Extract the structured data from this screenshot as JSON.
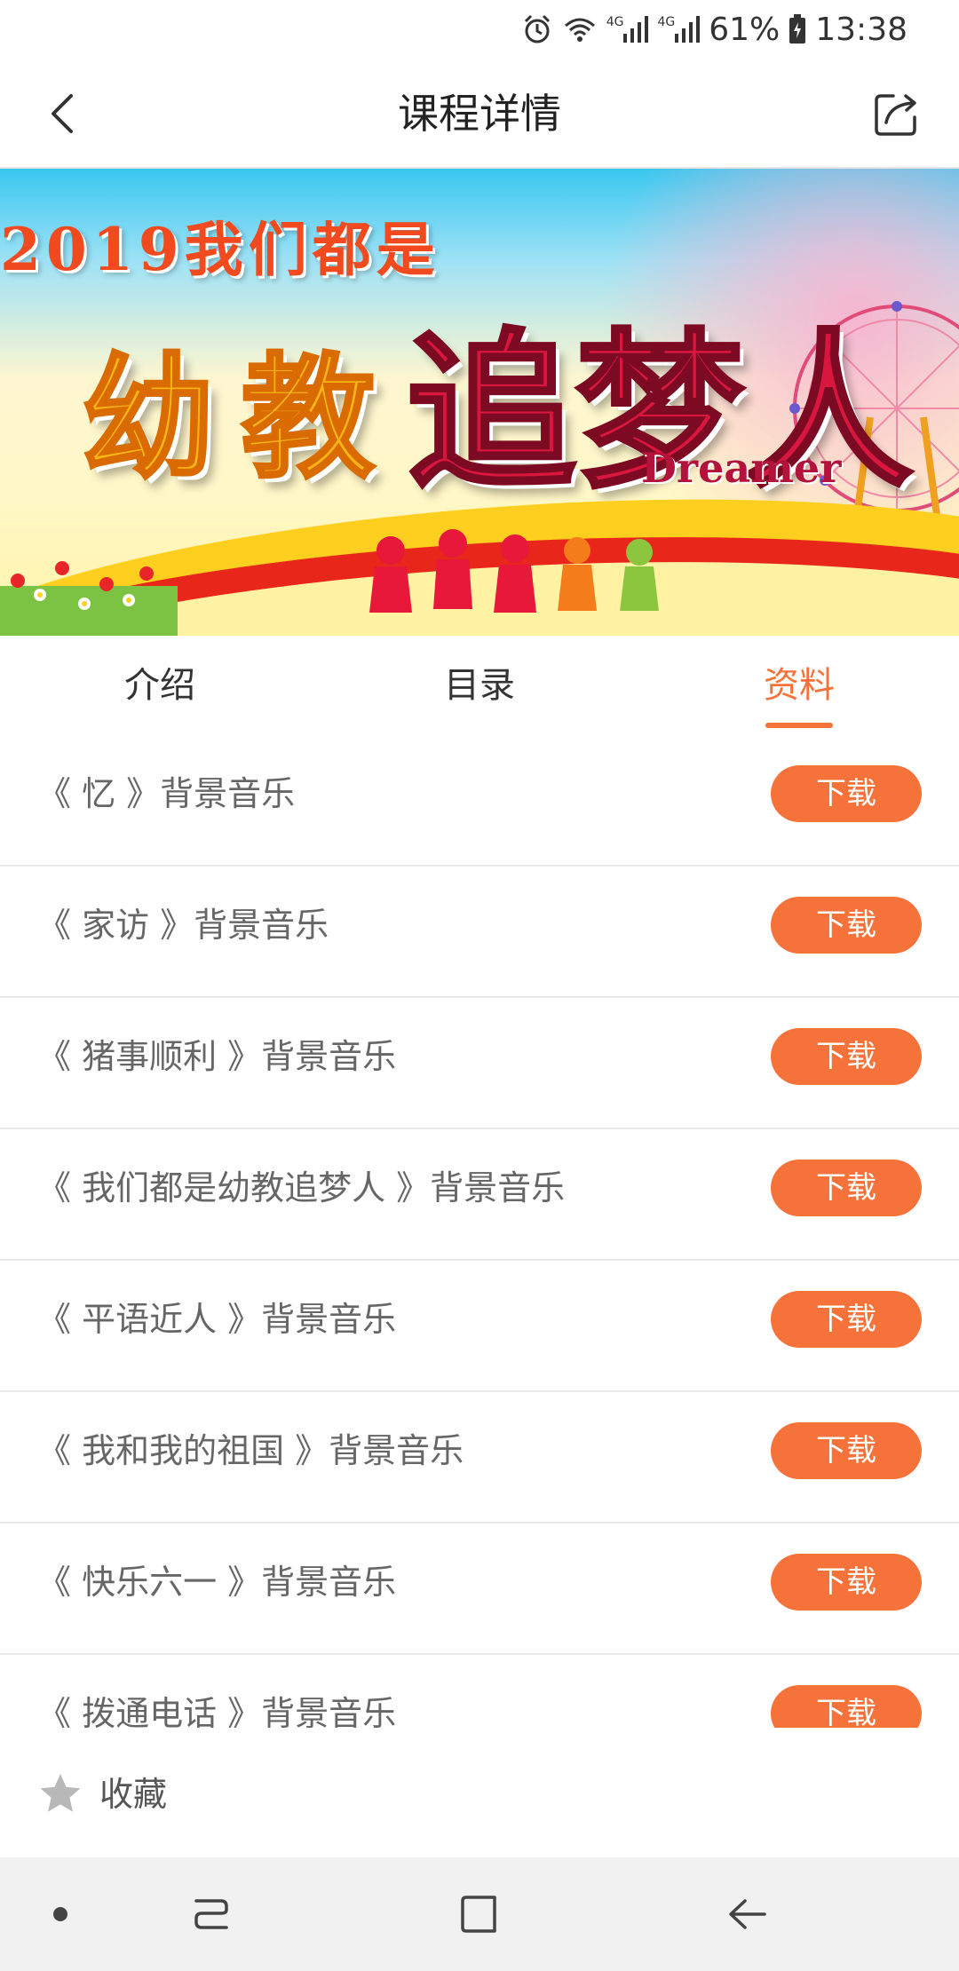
{
  "status_bar": {
    "battery": "61%",
    "time": "13:38",
    "network_1": "4G",
    "network_2": "4G"
  },
  "header": {
    "title": "课程详情"
  },
  "banner": {
    "year_line": "2019我们都是",
    "title_part1": "幼教",
    "title_part2": "追梦人",
    "subtitle": "Dreamer"
  },
  "tabs": [
    {
      "label": "介绍",
      "active": false
    },
    {
      "label": "目录",
      "active": false
    },
    {
      "label": "资料",
      "active": true
    }
  ],
  "materials": [
    {
      "name": "《 忆 》背景音乐",
      "action": "下载"
    },
    {
      "name": "《 家访 》背景音乐",
      "action": "下载"
    },
    {
      "name": "《 猪事顺利 》背景音乐",
      "action": "下载"
    },
    {
      "name": "《 我们都是幼教追梦人 》背景音乐",
      "action": "下载"
    },
    {
      "name": "《 平语近人 》背景音乐",
      "action": "下载"
    },
    {
      "name": "《 我和我的祖国 》背景音乐",
      "action": "下载"
    },
    {
      "name": "《 快乐六一 》背景音乐",
      "action": "下载"
    },
    {
      "name": "《 拨通电话 》背景音乐",
      "action": "下载"
    }
  ],
  "favorite": {
    "label": "收藏"
  },
  "colors": {
    "accent": "#f5733a",
    "divider": "#e8e8e8",
    "nav_bg": "#f1f1f1"
  }
}
